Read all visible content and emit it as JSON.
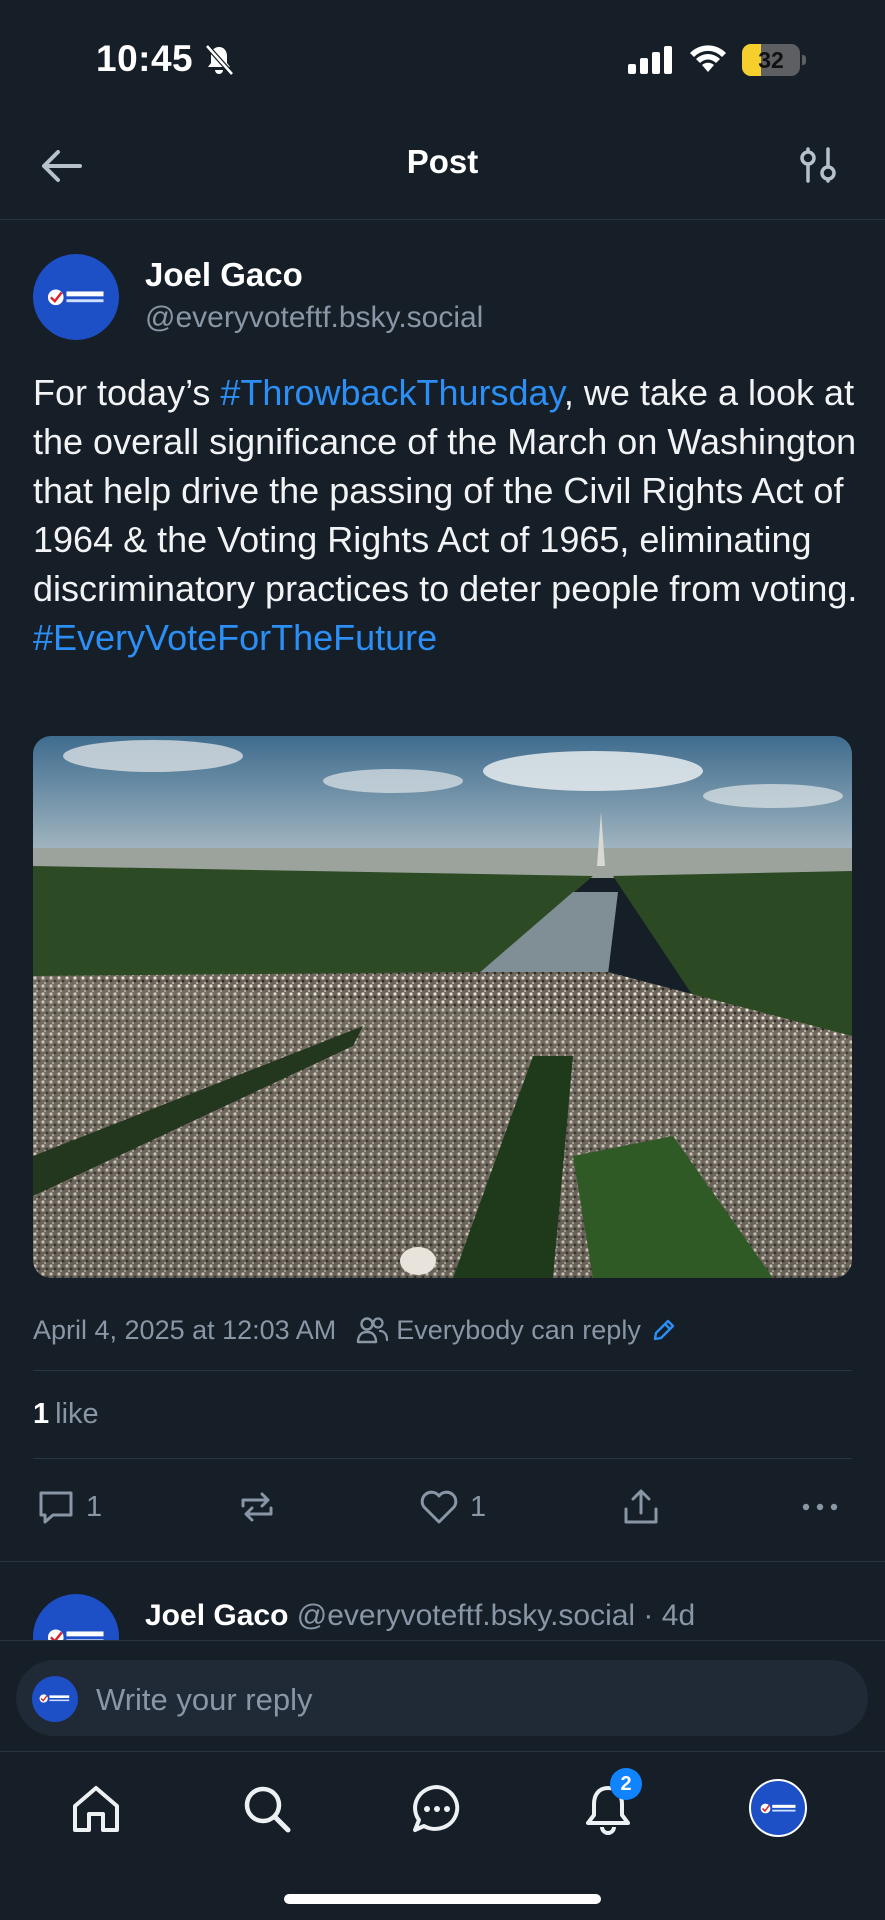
{
  "status_bar": {
    "time": "10:45",
    "battery_level": "32",
    "battery_fraction": 0.32,
    "icons": [
      "bell-slash-icon",
      "cellular-signal-icon",
      "wifi-icon",
      "battery-icon"
    ]
  },
  "header": {
    "title": "Post",
    "back_icon": "arrow-left-icon",
    "filter_icon": "sliders-icon"
  },
  "post": {
    "author_name": "Joel Gaco",
    "author_handle": "@everyvoteftf.bsky.social",
    "avatar_text": "EVERY VOTE FOR THE FUTURE",
    "text_part1": "For today’s ",
    "hashtag1": "#ThrowbackThursday",
    "text_part2": ", we take a look at the overall significance of the March on Washington that help drive the passing of the Civil Rights Act of 1964 & the Voting Rights Act of 1965, eliminating discriminatory practices to deter people from voting.",
    "hashtag2": "#EveryVoteForTheFuture",
    "timestamp": "April 4, 2025 at 12:03 AM",
    "reply_setting": "Everybody can reply",
    "likes_count": "1",
    "likes_label": "like",
    "actions": {
      "reply_count": "1",
      "like_count": "1"
    }
  },
  "reply_preview": {
    "author_name": "Joel Gaco",
    "author_meta": "@everyvoteftf.bsky.social · 4d"
  },
  "composer": {
    "placeholder": "Write your reply"
  },
  "bottom_nav": {
    "items": [
      "home-icon",
      "search-icon",
      "chat-icon",
      "bell-icon",
      "profile-avatar"
    ],
    "notification_badge": "2"
  },
  "colors": {
    "background": "#161e27",
    "accent": "#2b8ff5",
    "muted": "#8896a6",
    "avatar_blue": "#1d4fc7",
    "badge": "#1083fe"
  }
}
